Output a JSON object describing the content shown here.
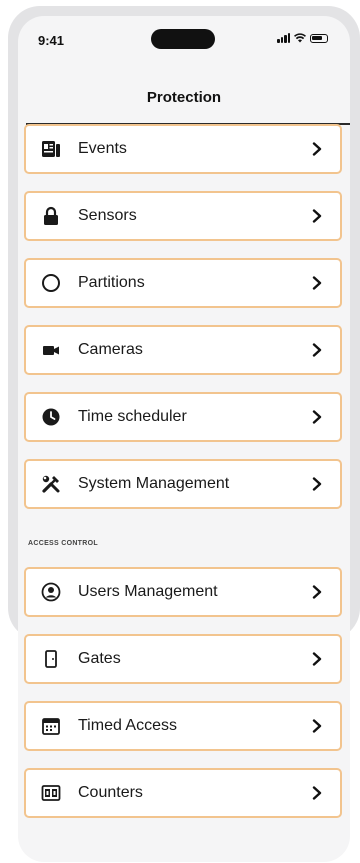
{
  "status_bar": {
    "time": "9:41"
  },
  "header": {
    "title": "Protection"
  },
  "menu": [
    {
      "label": "Events",
      "icon": "events-icon"
    },
    {
      "label": "Sensors",
      "icon": "lock-icon"
    },
    {
      "label": "Partitions",
      "icon": "circle-icon"
    },
    {
      "label": "Cameras",
      "icon": "camera-icon"
    },
    {
      "label": "Time scheduler",
      "icon": "clock-icon"
    },
    {
      "label": "System Management",
      "icon": "tools-icon"
    }
  ],
  "access_control": {
    "section_label": "ACCESS CONTROL",
    "items": [
      {
        "label": "Users Management",
        "icon": "user-circle-icon"
      },
      {
        "label": "Gates",
        "icon": "gate-icon"
      },
      {
        "label": "Timed Access",
        "icon": "calendar-icon"
      },
      {
        "label": "Counters",
        "icon": "counter-icon"
      }
    ]
  },
  "colors": {
    "item_border": "#f2c48e",
    "background": "#f5f5f6",
    "text": "#1a1a1a"
  }
}
